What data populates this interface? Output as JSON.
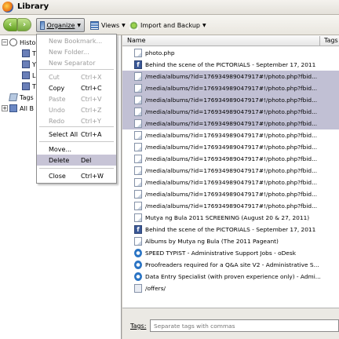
{
  "window": {
    "title": "Library"
  },
  "toolbar": {
    "back": "‹",
    "forward": "›",
    "organize_label": "Organize",
    "views_label": "Views",
    "import_label": "Import and Backup"
  },
  "sidebar": {
    "history_label": "Histo",
    "tags_label": "Tags",
    "all_bookmarks_label": "All B",
    "sub_items": [
      "T",
      "Y",
      "L",
      "T"
    ]
  },
  "organize_menu": {
    "items": [
      {
        "label": "New Bookmark...",
        "shortcut": "",
        "disabled": true
      },
      {
        "label": "New Folder...",
        "shortcut": "",
        "disabled": true
      },
      {
        "label": "New Separator",
        "shortcut": "",
        "disabled": true
      },
      {
        "label": "Cut",
        "shortcut": "Ctrl+X",
        "disabled": true
      },
      {
        "label": "Copy",
        "shortcut": "Ctrl+C",
        "disabled": false
      },
      {
        "label": "Paste",
        "shortcut": "Ctrl+V",
        "disabled": true
      },
      {
        "label": "Undo",
        "shortcut": "Ctrl+Z",
        "disabled": true
      },
      {
        "label": "Redo",
        "shortcut": "Ctrl+Y",
        "disabled": true
      },
      {
        "label": "Select All",
        "shortcut": "Ctrl+A",
        "disabled": false
      },
      {
        "label": "Move...",
        "shortcut": "",
        "disabled": false
      },
      {
        "label": "Delete",
        "shortcut": "Del",
        "disabled": false,
        "highlighted": true
      },
      {
        "label": "Close",
        "shortcut": "Ctrl+W",
        "disabled": false
      }
    ]
  },
  "columns": {
    "name": "Name",
    "tags": "Tags"
  },
  "rows": [
    {
      "title": "photo.php",
      "icon": "page",
      "selected": false
    },
    {
      "title": "Behind the scene of the PICTORIALS - September 17, 2011",
      "icon": "fb",
      "selected": false
    },
    {
      "title": "/media/albums/?id=176934989047917#!/photo.php?fbid...",
      "icon": "page",
      "selected": true
    },
    {
      "title": "/media/albums/?id=176934989047917#!/photo.php?fbid...",
      "icon": "page",
      "selected": true
    },
    {
      "title": "/media/albums/?id=176934989047917#!/photo.php?fbid...",
      "icon": "page",
      "selected": true
    },
    {
      "title": "/media/albums/?id=176934989047917#!/photo.php?fbid...",
      "icon": "page",
      "selected": true
    },
    {
      "title": "/media/albums/?id=176934989047917#!/photo.php?fbid...",
      "icon": "page",
      "selected": true
    },
    {
      "title": "/media/albums/?id=176934989047917#!/photo.php?fbid...",
      "icon": "page",
      "selected": false
    },
    {
      "title": "/media/albums/?id=176934989047917#!/photo.php?fbid...",
      "icon": "page",
      "selected": false
    },
    {
      "title": "/media/albums/?id=176934989047917#!/photo.php?fbid...",
      "icon": "page",
      "selected": false
    },
    {
      "title": "/media/albums/?id=176934989047917#!/photo.php?fbid...",
      "icon": "page",
      "selected": false
    },
    {
      "title": "/media/albums/?id=176934989047917#!/photo.php?fbid...",
      "icon": "page",
      "selected": false
    },
    {
      "title": "/media/albums/?id=176934989047917#!/photo.php?fbid...",
      "icon": "page",
      "selected": false
    },
    {
      "title": "/media/albums/?id=176934989047917#!/photo.php?fbid...",
      "icon": "page",
      "selected": false
    },
    {
      "title": "Mutya ng Bula 2011 SCREENING (August 20 & 27, 2011)",
      "icon": "page",
      "selected": false
    },
    {
      "title": "Behind the scene of the PICTORIALS - September 17, 2011",
      "icon": "fb",
      "selected": false
    },
    {
      "title": "Albums by Mutya ng Bula (The 2011 Pageant)",
      "icon": "page",
      "selected": false
    },
    {
      "title": "SPEED TYPIST - Administrative Support Jobs - oDesk",
      "icon": "odesk",
      "selected": false
    },
    {
      "title": "Proofreaders required for a Q&A site V2 - Administrative S...",
      "icon": "odesk",
      "selected": false
    },
    {
      "title": "Data Entry Specialist (with proven experience only) - Admi...",
      "icon": "odesk",
      "selected": false
    },
    {
      "title": "/offers/",
      "icon": "doc",
      "selected": false
    }
  ],
  "tags_panel": {
    "label": "Tags:",
    "placeholder": "Separate tags with commas"
  }
}
